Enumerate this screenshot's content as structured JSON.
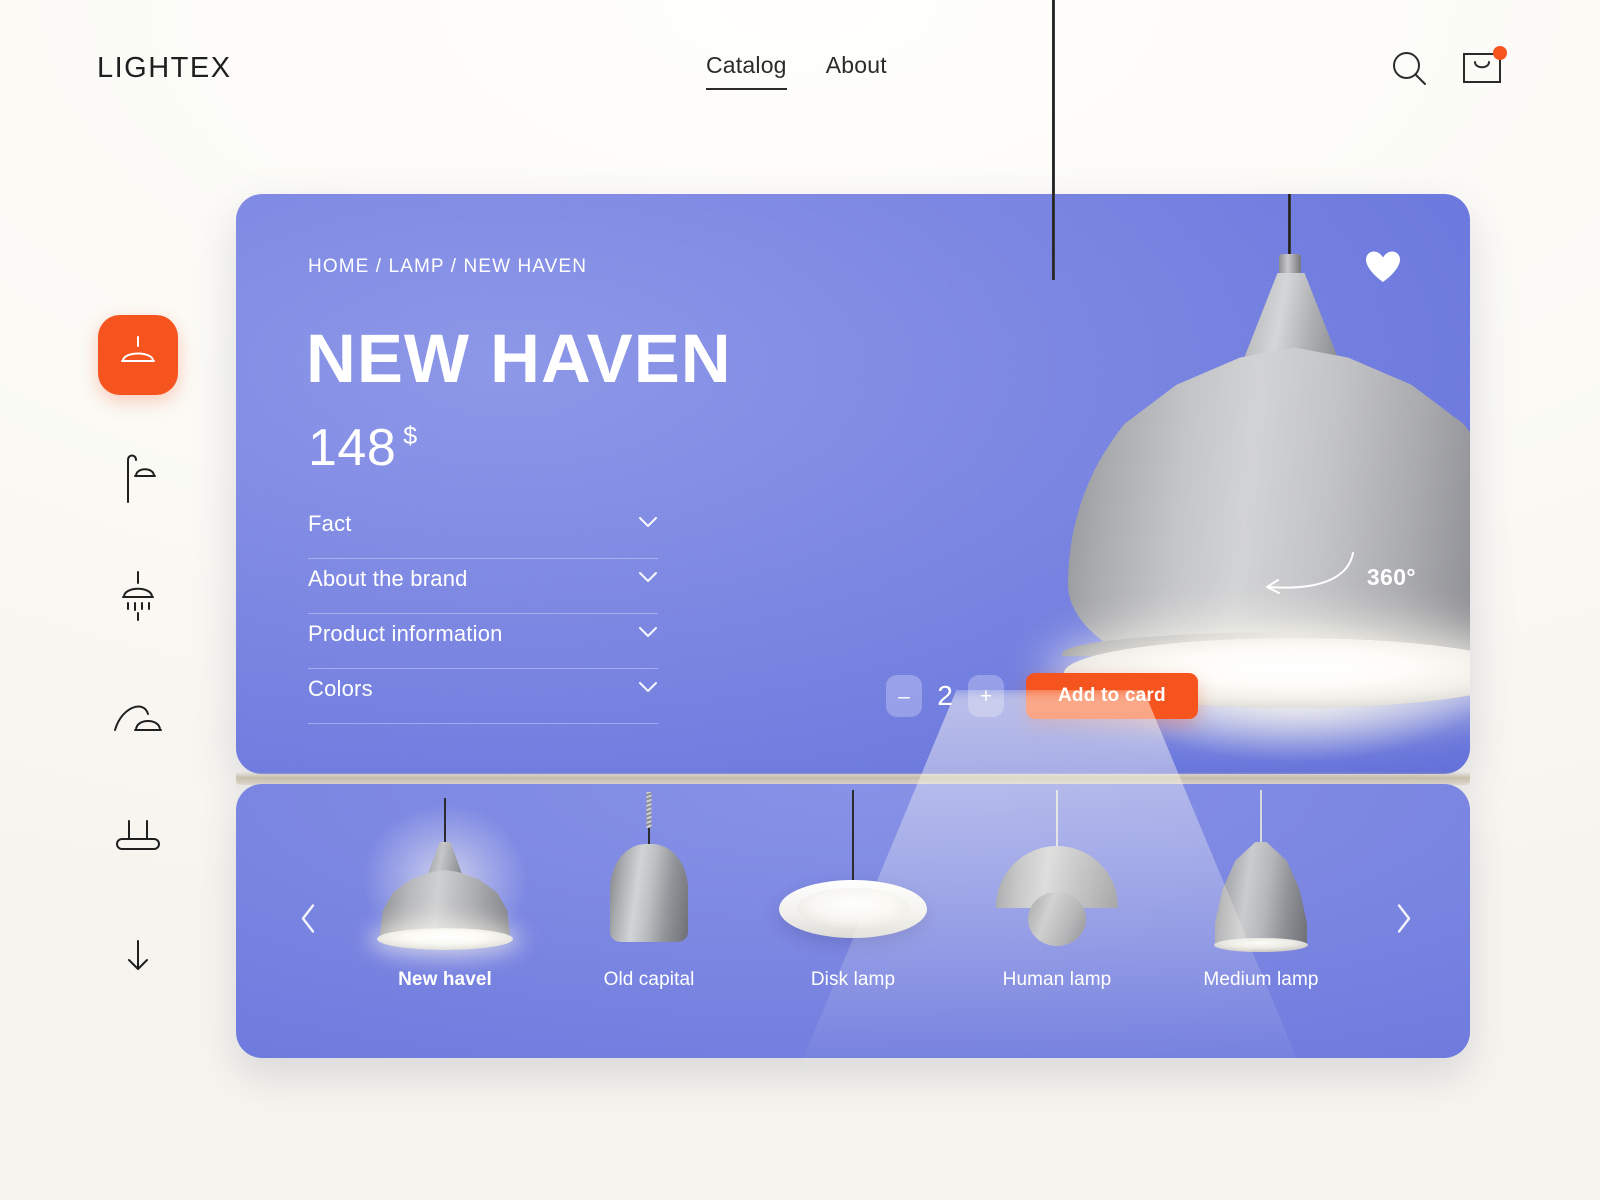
{
  "brand": {
    "logo": "LIGHTEX"
  },
  "nav": {
    "items": [
      {
        "label": "Catalog",
        "active": true
      },
      {
        "label": "About",
        "active": false
      }
    ]
  },
  "header_actions": {
    "search_icon": "search-icon",
    "cart_icon": "shopping-bag-icon",
    "cart_has_notification": true,
    "notification_color": "#F6541F"
  },
  "sidebar": {
    "items": [
      {
        "icon": "pendant-lamp-icon",
        "active": true
      },
      {
        "icon": "street-lamp-icon",
        "active": false
      },
      {
        "icon": "shower-lamp-icon",
        "active": false
      },
      {
        "icon": "arc-lamp-icon",
        "active": false
      },
      {
        "icon": "bar-pendant-lamp-icon",
        "active": false
      },
      {
        "icon": "arrow-down-icon",
        "active": false
      }
    ],
    "active_color": "#F6541F"
  },
  "product": {
    "breadcrumb": "HOME / LAMP / NEW HAVEN",
    "title": "NEW HAVEN",
    "price_value": "148",
    "price_currency": "$",
    "favorite_icon": "heart-icon",
    "rotate_label": "360°",
    "rotate_icon": "rotate-arrow-icon",
    "accordion": [
      {
        "label": "Fact",
        "icon": "chevron-down-icon"
      },
      {
        "label": "About the brand",
        "icon": "chevron-down-icon"
      },
      {
        "label": "Product information",
        "icon": "chevron-down-icon"
      },
      {
        "label": "Colors",
        "icon": "chevron-down-icon"
      }
    ],
    "quantity": {
      "decrement_label": "–",
      "value": "2",
      "increment_label": "+"
    },
    "add_to_cart_label": "Add to card",
    "accent_color": "#F6541F",
    "card_color": "#7481DE"
  },
  "carousel": {
    "prev_icon": "chevron-left-icon",
    "next_icon": "chevron-right-icon",
    "items": [
      {
        "label": "New havel",
        "active": true
      },
      {
        "label": "Old capital",
        "active": false
      },
      {
        "label": "Disk lamp",
        "active": false
      },
      {
        "label": "Human lamp",
        "active": false
      },
      {
        "label": "Medium lamp",
        "active": false
      }
    ]
  }
}
